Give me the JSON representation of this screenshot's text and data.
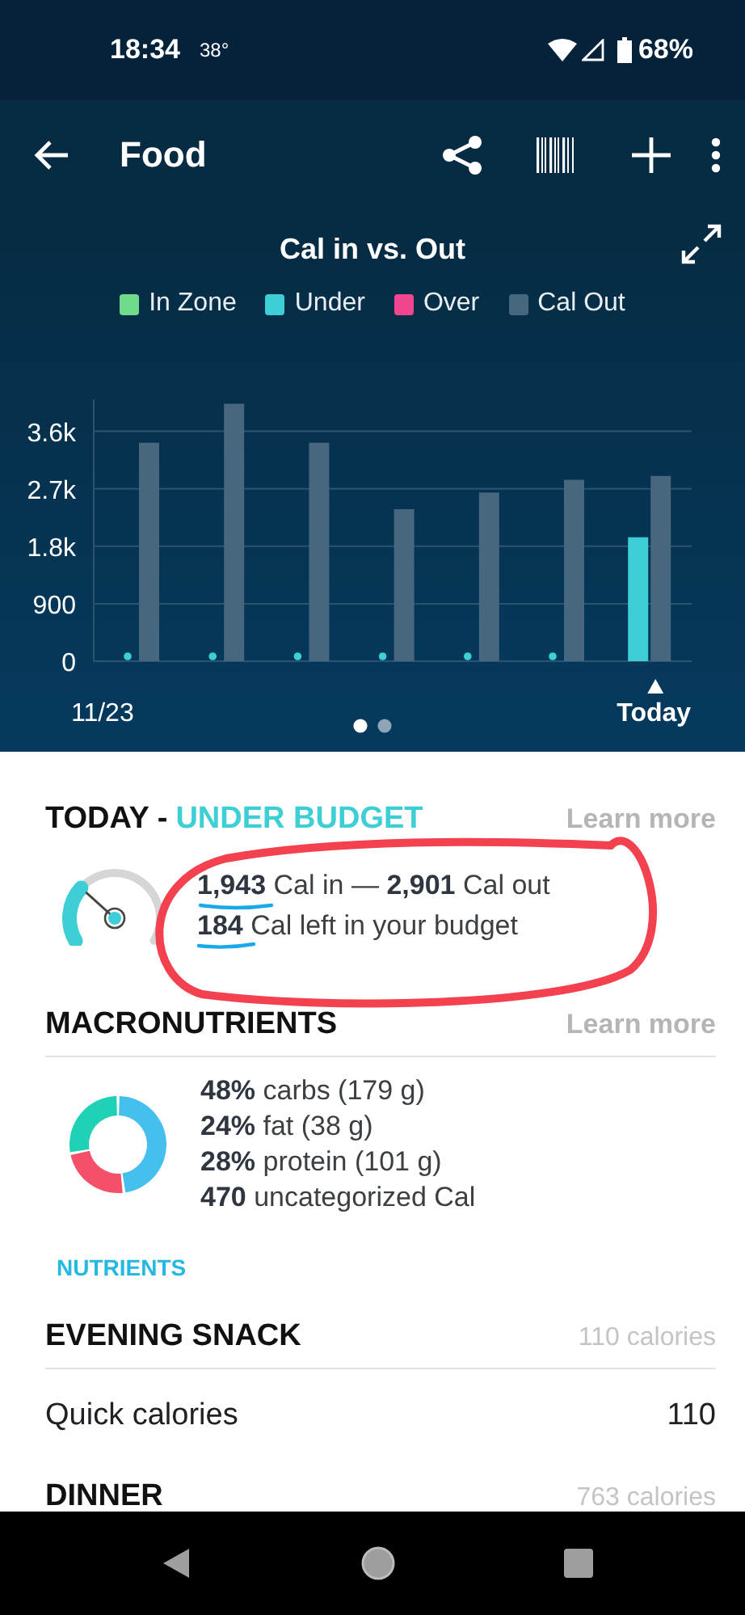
{
  "status_bar": {
    "time": "18:34",
    "temperature": "38°",
    "battery": "68%"
  },
  "app_bar": {
    "title": "Food"
  },
  "chart": {
    "title": "Cal in vs. Out",
    "chart_data": {
      "type": "bar",
      "categories": [
        "11/23",
        null,
        null,
        null,
        null,
        null,
        "Today"
      ],
      "ylim": [
        0,
        4100
      ],
      "grid": true,
      "yticks": [
        {
          "value": 0,
          "label": "0"
        },
        {
          "value": 900,
          "label": "900"
        },
        {
          "value": 1800,
          "label": "1.8k"
        },
        {
          "value": 2700,
          "label": "2.7k"
        },
        {
          "value": 3600,
          "label": "3.6k"
        }
      ],
      "series": [
        {
          "name": "In Zone",
          "color": "#6fdc8c",
          "values": [
            null,
            null,
            null,
            null,
            null,
            null,
            null
          ]
        },
        {
          "name": "Under",
          "color": "#3ecfd6",
          "values": [
            0,
            0,
            0,
            0,
            0,
            0,
            1940
          ]
        },
        {
          "name": "Over",
          "color": "#f2458f",
          "values": [
            null,
            null,
            null,
            null,
            null,
            null,
            null
          ]
        },
        {
          "name": "Cal Out",
          "color": "#46677d",
          "values": [
            3420,
            4030,
            3420,
            2380,
            2640,
            2840,
            2900
          ]
        }
      ]
    },
    "pages": [
      {
        "selected": true
      },
      {
        "selected": false
      }
    ]
  },
  "today": {
    "heading": "TODAY -",
    "status": "UNDER BUDGET",
    "link": "Learn more",
    "lines": [
      "**1,943** Cal in — **2,901** Cal out",
      "**184** Cal left in your budget"
    ]
  },
  "macronutrients": {
    "heading": "MACRONUTRIENTS",
    "link": "Learn more",
    "items": [
      "**48%** carbs (179 g)",
      "**24%** fat (38 g)",
      "**28%** protein (101 g)",
      "**470** uncategorized Cal"
    ],
    "chart_data": {
      "type": "donut",
      "values": [
        48,
        24,
        28
      ]
    }
  },
  "nutrients_link": "NUTRIENTS",
  "meals": [
    {
      "name": "EVENING SNACK",
      "calories": "110 calories",
      "entries": [
        {
          "name": "Quick calories",
          "calories": "110"
        }
      ]
    },
    {
      "name": "DINNER",
      "calories": "763 calories"
    }
  ]
}
